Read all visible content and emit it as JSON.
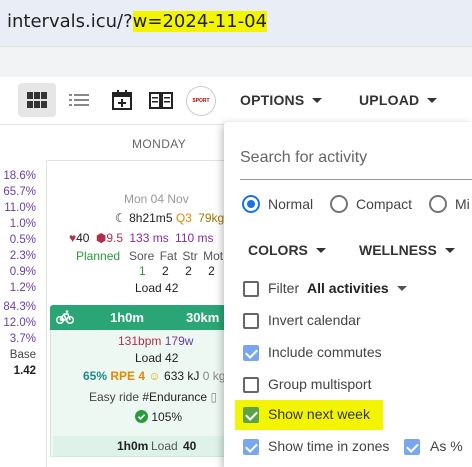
{
  "browser": {
    "url_prefix": "intervals.icu/?",
    "url_param": "w=2024-11-04"
  },
  "toolbar": {
    "options_label": "OPTIONS",
    "upload_label": "UPLOAD",
    "logo_text": "SPORT"
  },
  "calendar": {
    "day_header": "MONDAY",
    "date": "Mon 04 Nov",
    "sleep": "8h21m",
    "sleep_quality": "5",
    "sleep_q": "Q3",
    "weight": "79kg",
    "hr_rest": "40",
    "hrv_val": "9.5",
    "hrv_ms1": "133 ms",
    "hrv_ms2": "110 ms",
    "planned_label": "Planned",
    "wellness_headers": [
      "Sore",
      "Fat",
      "Str",
      "Mot"
    ],
    "wellness_values": [
      "1",
      "2",
      "2",
      "2"
    ],
    "load_planned": "Load 42",
    "activity": {
      "duration": "1h0m",
      "time": "30km",
      "avg_hr": "131bpm",
      "avg_power": "179w",
      "load": "Load 42",
      "intensity": "65%",
      "rpe": "RPE 4",
      "energy": "633 kJ",
      "kg": "0 kg",
      "name": "Easy ride",
      "tag": "#Endurance",
      "compliance": "105%"
    },
    "summary_duration": "1h0m",
    "summary_load": "Load",
    "summary_load_value": "40"
  },
  "stats": [
    "18.6%",
    "65.7%",
    "11.0%",
    "1.0%",
    "0.5%",
    "2.3%",
    "0.9%",
    "1.2%",
    "84.3%",
    "12.0%",
    "3.7%",
    "Base",
    "1.42"
  ],
  "panel": {
    "search_placeholder": "Search for activity",
    "radios": [
      "Normal",
      "Compact",
      "Mi"
    ],
    "colors_label": "COLORS",
    "wellness_label": "WELLNESS",
    "filter_label": "Filter",
    "filter_value": "All activities",
    "checkboxes": [
      "Invert calendar",
      "Include commutes",
      "Group multisport",
      "Show next week",
      "Show time in zones"
    ],
    "as_percent": "As %"
  },
  "colors": {
    "green": "#2aa676",
    "purple": "#6a3fa0",
    "highlight": "#f3f500",
    "checkbox_blue": "#78a7f0"
  }
}
